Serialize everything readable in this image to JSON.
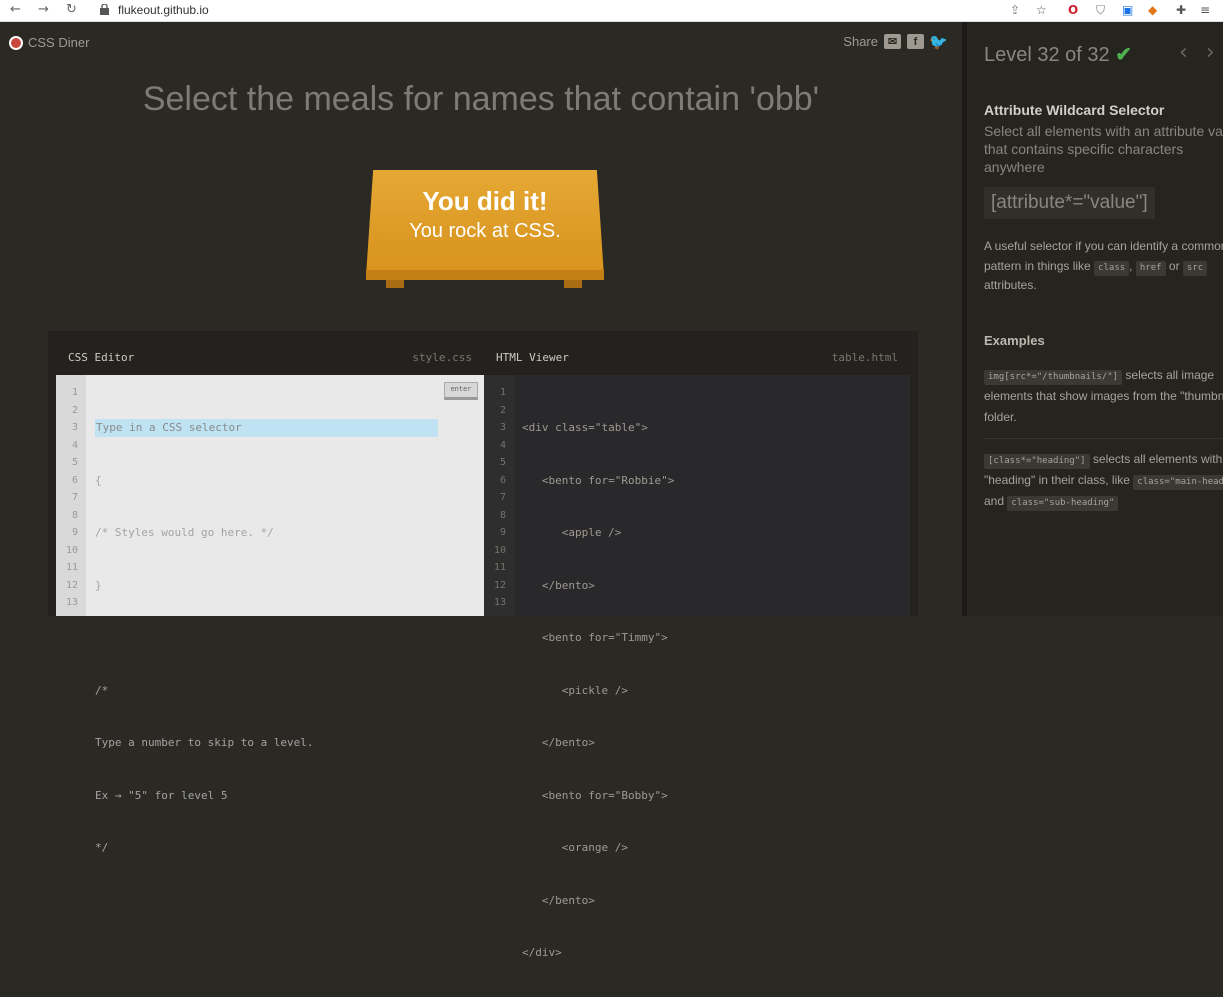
{
  "browser": {
    "url": "flukeout.github.io",
    "back": "←",
    "forward": "→",
    "reload": "↻"
  },
  "app": {
    "logo_text": "CSS Diner",
    "share_label": "Share",
    "share_icons": [
      "mail-icon",
      "facebook-icon",
      "twitter-icon"
    ]
  },
  "main": {
    "instruction": "Select the meals for names that contain 'obb'",
    "win_line1": "You did it!",
    "win_line2": "You rock at CSS."
  },
  "css_editor": {
    "label": "CSS Editor",
    "file": "style.css",
    "placeholder": "Type in a CSS selector",
    "enter_label": "enter",
    "line_numbers": [
      "1",
      "2",
      "3",
      "4",
      "5",
      "6",
      "7",
      "8",
      "9",
      "10",
      "11",
      "12",
      "13"
    ],
    "lines": [
      "{",
      "/* Styles would go here. */",
      "}",
      "",
      "/*",
      "Type a number to skip to a level.",
      "Ex → \"5\" for level 5",
      "*/"
    ]
  },
  "html_viewer": {
    "label": "HTML Viewer",
    "file": "table.html",
    "line_numbers": [
      "1",
      "2",
      "3",
      "4",
      "5",
      "6",
      "7",
      "8",
      "9",
      "10",
      "11",
      "12",
      "13"
    ],
    "lines": [
      "<div class=\"table\">",
      "   <bento for=\"Robbie\">",
      "      <apple />",
      "   </bento>",
      "   <bento for=\"Timmy\">",
      "      <pickle />",
      "   </bento>",
      "   <bento for=\"Bobby\">",
      "      <orange />",
      "   </bento>",
      "</div>"
    ]
  },
  "sidebar": {
    "level": "Level 32 of 32",
    "check": "✔",
    "prev": "‹",
    "next": "›",
    "selector_name": "Attribute Wildcard Selector",
    "selector_desc": "Select all elements with an attribute value that contains specific characters anywhere",
    "syntax": "[attribute*=\"value\"]",
    "hint_pre": "A useful selector if you can identify a common pattern in things like",
    "hint_tag1": "class",
    "hint_sep": ",",
    "hint_tag2": "href",
    "hint_or": "or",
    "hint_tag3": "src",
    "hint_post": "attributes.",
    "examples_title": "Examples",
    "ex1_code": "img[src*=\"/thumbnails/\"]",
    "ex1_text": "selects all image elements that show images from the \"thumbnails\" folder.",
    "ex2_code": "[class*=\"heading\"]",
    "ex2_text_a": "selects all elements with \"heading\" in their class, like",
    "ex2_code2": "class=\"main-heading\"",
    "ex2_and": "and",
    "ex2_code3": "class=\"sub-heading\""
  },
  "colors": {
    "background": "#2b2924",
    "accent_table": "#e6a834",
    "check": "#4cb050",
    "logo": "#c7473e"
  }
}
